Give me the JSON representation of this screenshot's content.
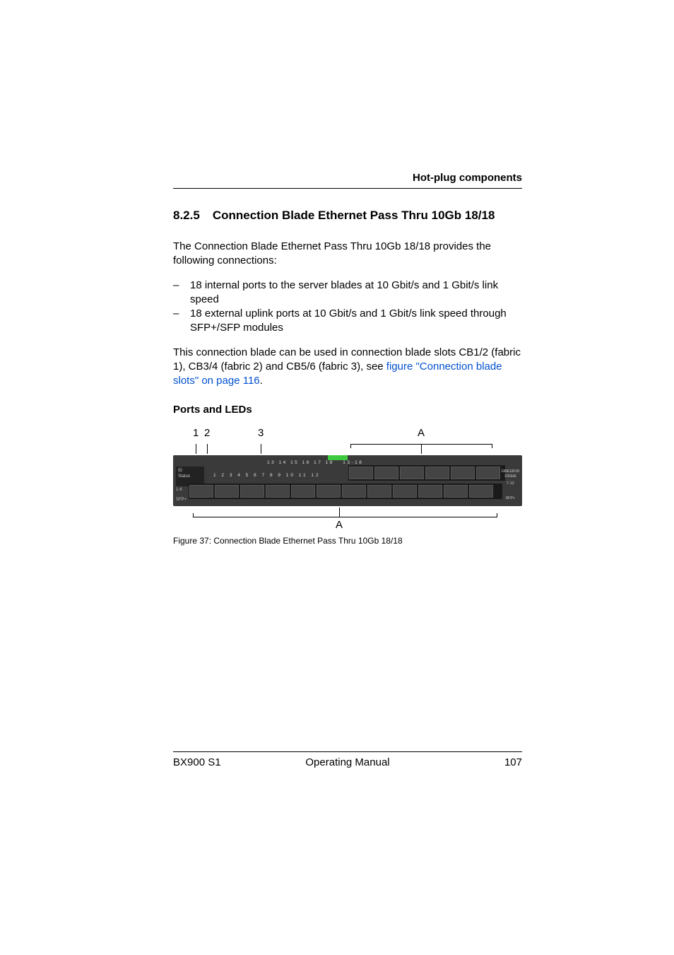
{
  "header": {
    "right_text": "Hot-plug components"
  },
  "section": {
    "number": "8.2.5",
    "title": "Connection Blade Ethernet Pass Thru 10Gb 18/18"
  },
  "intro_text": "The Connection Blade Ethernet Pass Thru 10Gb 18/18 provides the following connections:",
  "bullets": [
    "18 internal ports to the server blades at 10 Gbit/s and 1 Gbit/s link speed",
    "18 external uplink ports at 10 Gbit/s and 1 Gbit/s link speed through SFP+/SFP modules"
  ],
  "slot_text_pre": "This connection blade can be used in connection blade slots CB1/2 (fabric 1), CB3/4 (fabric 2) and CB5/6 (fabric 3), see ",
  "slot_link": "figure \"Connection blade slots\" on page 116",
  "slot_text_post": ".",
  "subheading": "Ports and LEDs",
  "figure": {
    "top_labels": {
      "l1": "1",
      "l2": "2",
      "l3": "3",
      "lA": "A"
    },
    "bottom_label": "A",
    "panel": {
      "id_text": "ID",
      "status_text": "Status",
      "ports_top": "13  14  15  16  17  18",
      "ports_top_extra": "13-18",
      "ports_bottom": "1   2   3   4   5   6       7   8   9   10  11  12",
      "ports_bottom_extra": "SFP+",
      "right_label_1": "GBE18/18",
      "right_label_2": "10GbE",
      "right_label_3": "7-12",
      "right_label_4": "SFP+",
      "sfp_left": "1-6",
      "sfp_left2": "SFP+"
    },
    "caption": "Figure 37: Connection Blade Ethernet Pass Thru 10Gb 18/18"
  },
  "footer": {
    "left": "BX900 S1",
    "center": "Operating Manual",
    "right": "107"
  }
}
